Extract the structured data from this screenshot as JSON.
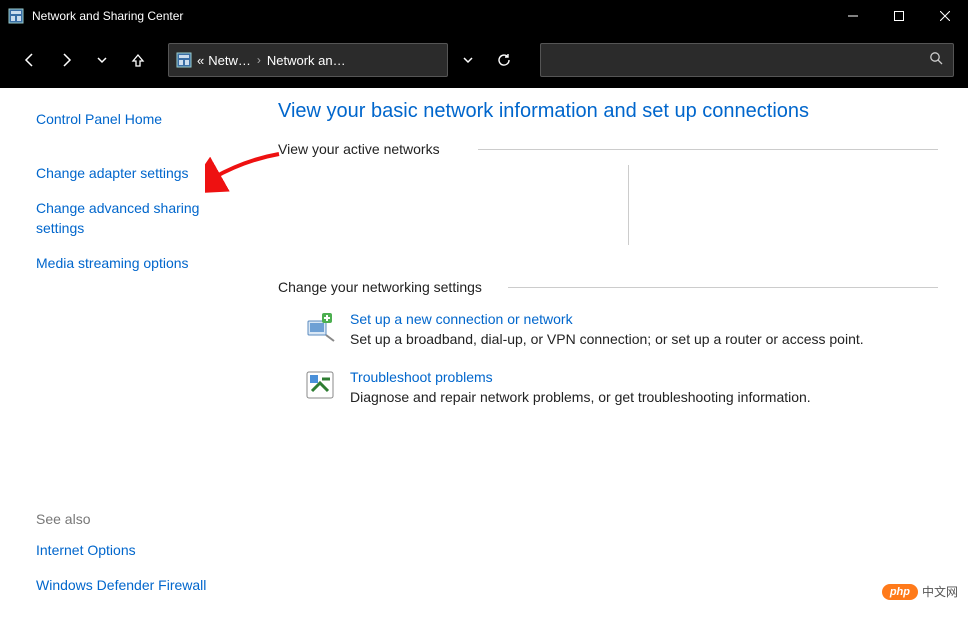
{
  "window": {
    "title": "Network and Sharing Center"
  },
  "breadcrumb": {
    "prefix": "«",
    "item1": "Netw…",
    "item2": "Network an…"
  },
  "sidebar": {
    "home": "Control Panel Home",
    "links": [
      "Change adapter settings",
      "Change advanced sharing settings",
      "Media streaming options"
    ],
    "see_also_title": "See also",
    "see_also_links": [
      "Internet Options",
      "Windows Defender Firewall"
    ]
  },
  "main": {
    "title": "View your basic network information and set up connections",
    "active_heading": "View your active networks",
    "change_heading": "Change your networking settings",
    "settings": [
      {
        "link": "Set up a new connection or network",
        "desc": "Set up a broadband, dial-up, or VPN connection; or set up a router or access point."
      },
      {
        "link": "Troubleshoot problems",
        "desc": "Diagnose and repair network problems, or get troubleshooting information."
      }
    ]
  },
  "watermark": {
    "badge": "php",
    "text": "中文网"
  }
}
